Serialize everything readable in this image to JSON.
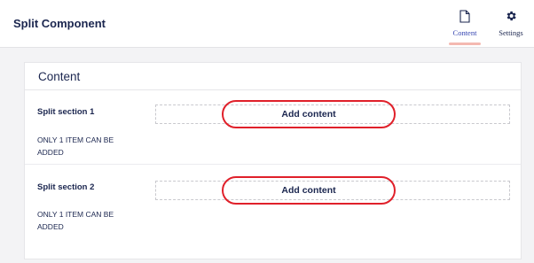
{
  "header": {
    "title": "Split Component",
    "tabs": [
      {
        "label": "Content",
        "icon": "document-icon",
        "active": true
      },
      {
        "label": "Settings",
        "icon": "gear-icon",
        "active": false
      }
    ]
  },
  "panel": {
    "title": "Content",
    "sections": [
      {
        "label": "Split section 1",
        "note": "ONLY 1 ITEM CAN BE ADDED",
        "button_label": "Add content"
      },
      {
        "label": "Split section 2",
        "note": "ONLY 1 ITEM CAN BE ADDED",
        "button_label": "Add content"
      }
    ]
  },
  "colors": {
    "text": "#1b264f",
    "active_tab": "#3544b1",
    "tab_underline": "#f4b9b1",
    "highlight_ring": "#e0202a",
    "background": "#f3f3f5"
  }
}
